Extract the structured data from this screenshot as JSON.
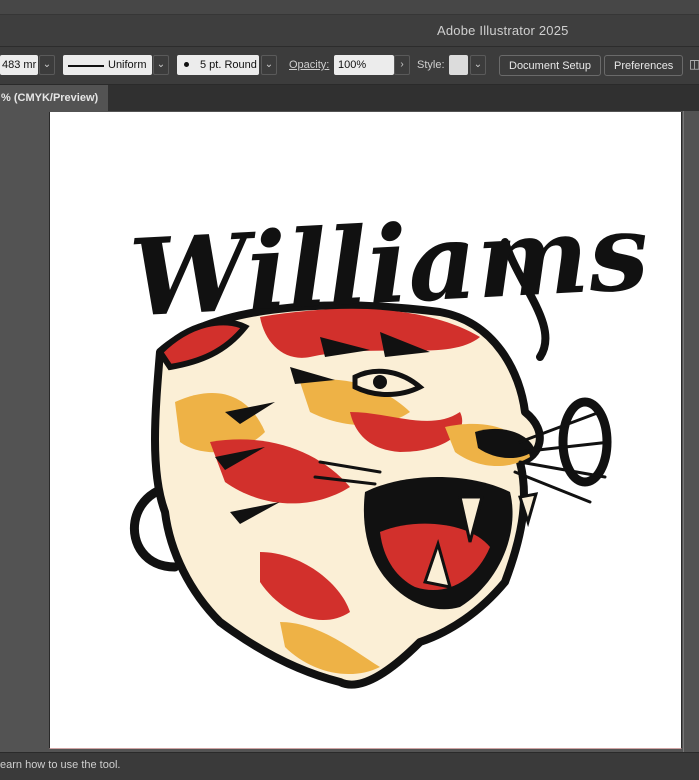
{
  "app": {
    "title": "Adobe Illustrator 2025"
  },
  "control_bar": {
    "stroke_weight": "483 mr",
    "stroke_profile": "Uniform",
    "brush": "5 pt. Round",
    "opacity_label": "Opacity:",
    "opacity_value": "100%",
    "style_label": "Style:",
    "document_setup_label": "Document Setup",
    "preferences_label": "Preferences"
  },
  "document_tab": {
    "label": "% (CMYK/Preview)"
  },
  "artwork": {
    "script_text": "Williams",
    "colors": {
      "ink": "#111111",
      "red": "#d2302c",
      "orange": "#eeb246",
      "cream": "#fbefd6"
    }
  },
  "status_bar": {
    "hint": "earn how to use the tool."
  }
}
